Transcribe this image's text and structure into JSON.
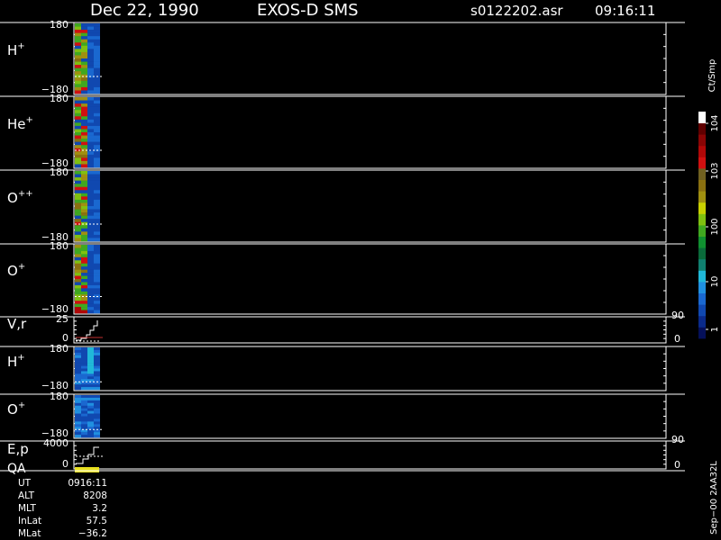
{
  "header": {
    "date": "Dec 22, 1990",
    "instrument": "EXOS-D SMS",
    "file": "s0122202.asr",
    "time": "09:16:11"
  },
  "colors": {
    "background": "#000000",
    "frame": "#ffffff",
    "scale": [
      "#05105a",
      "#0a2a8a",
      "#1048b0",
      "#1a68d0",
      "#2090e0",
      "#20b8d8",
      "#108070",
      "#0a6a3a",
      "#109030",
      "#40a820",
      "#80c010",
      "#c8d000",
      "#a09010",
      "#8a7010",
      "#706020",
      "#d01010",
      "#b00808",
      "#8a0505",
      "#600000",
      "#ffffff"
    ]
  },
  "colorbar": {
    "unit": "Ct/Smp",
    "ticks": [
      "1",
      "10",
      "100",
      "10^3",
      "10^4"
    ]
  },
  "panels": [
    {
      "id": "h-plus",
      "label": "H",
      "sup": "+",
      "ymax": "180",
      "ymin": "−180"
    },
    {
      "id": "he-plus",
      "label": "He",
      "sup": "+",
      "ymax": "180",
      "ymin": "−180"
    },
    {
      "id": "o-pp",
      "label": "O",
      "sup": "++",
      "ymax": "180",
      "ymin": "−180"
    },
    {
      "id": "o-plus",
      "label": "O",
      "sup": "+",
      "ymax": "180",
      "ymin": "−180"
    },
    {
      "id": "vr",
      "label": "V,r",
      "sup": "",
      "ymax": "25",
      "ymin": "0",
      "right_top": "90",
      "right_bottom": "0"
    },
    {
      "id": "h-plus-2",
      "label": "H",
      "sup": "+",
      "ymax": "180",
      "ymin": "−180"
    },
    {
      "id": "o-plus-2",
      "label": "O",
      "sup": "+",
      "ymax": "180",
      "ymin": "−180"
    },
    {
      "id": "ep",
      "label": "E,p",
      "sup": "",
      "label2": "QA",
      "ymax": "4000",
      "ymin": "0",
      "right_top": "90",
      "right_bottom": "0"
    }
  ],
  "orbit_info": [
    {
      "key": "UT",
      "value": "0916:11"
    },
    {
      "key": "ALT",
      "value": "8208"
    },
    {
      "key": "MLT",
      "value": "3.2"
    },
    {
      "key": "InLat",
      "value": "57.5"
    },
    {
      "key": "MLat",
      "value": "−36.2"
    }
  ],
  "footer_label": "Sep−00  2AA32L"
}
